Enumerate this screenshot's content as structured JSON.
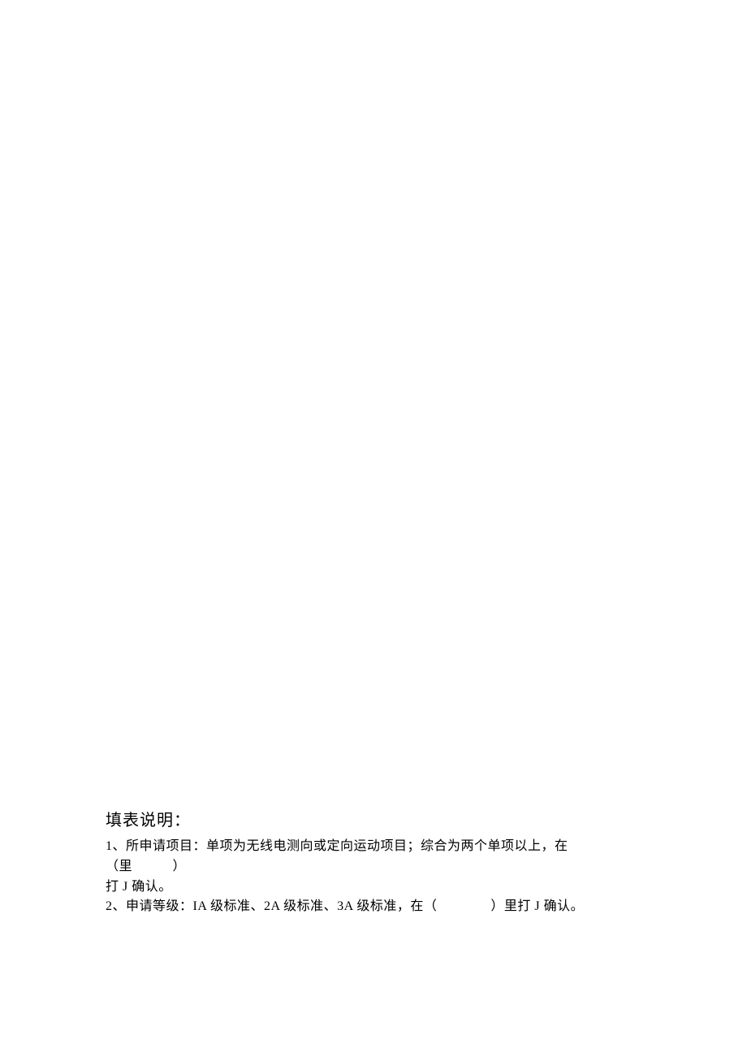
{
  "instructions": {
    "title": "填表说明：",
    "item1_line1": "1、所申请项目：单项为无线电测向或定向运动项目；综合为两个单项以上，在（里　　　）",
    "item1_line2": "打 J 确认。",
    "item2": "2、申请等级：IA 级标准、2A 级标准、3A 级标准，在（　　　　）里打 J 确认。"
  }
}
